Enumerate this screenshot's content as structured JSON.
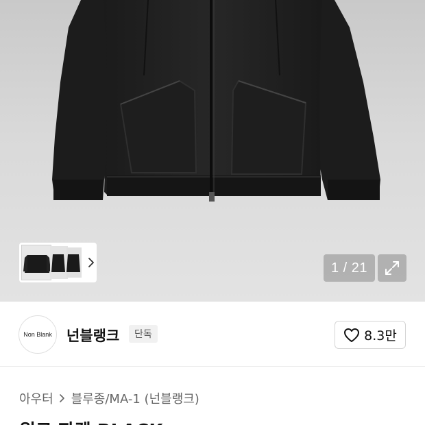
{
  "gallery": {
    "counter_text": "1 / 21",
    "expand_icon": "expand-arrows-icon",
    "next_icon": "chevron-right-icon"
  },
  "brand": {
    "logo_text": "Non Blank",
    "name": "넌블랭크",
    "badge": "단독"
  },
  "like": {
    "icon": "heart-outline-icon",
    "count": "8.3만"
  },
  "breadcrumb": {
    "items": [
      "아우터",
      "블루종/MA-1 (넌블랭크)"
    ]
  },
  "product": {
    "title": "워크 자켓 BLACK"
  }
}
